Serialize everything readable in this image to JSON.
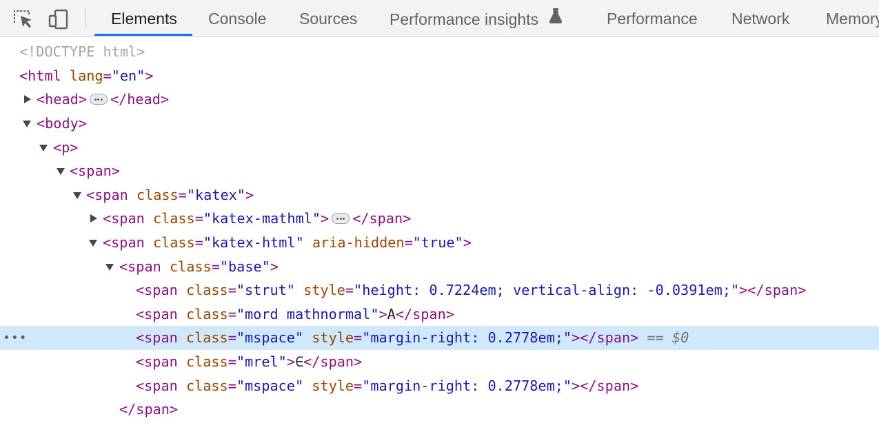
{
  "tabs": [
    "Elements",
    "Console",
    "Sources",
    "Performance insights",
    "Performance",
    "Network",
    "Memory"
  ],
  "active_tab": "Elements",
  "icons": {
    "inspect": "inspect-element-icon",
    "device": "device-toolbar-icon",
    "experiment": "flask-icon"
  },
  "tree": {
    "doctype": "<!DOCTYPE html>",
    "html": {
      "open": "<html",
      "attr": "lang",
      "eq": "=",
      "val": "\"en\"",
      "close": ">"
    },
    "head": {
      "open": "<head>",
      "close": "</head>"
    },
    "body": "<body>",
    "p": "<p>",
    "span": "<span>",
    "katex": {
      "open": "<span",
      "attr": "class",
      "val": "\"katex\"",
      "close": ">"
    },
    "mathml": {
      "open": "<span",
      "attr": "class",
      "val": "\"katex-mathml\"",
      "close": ">",
      "end": "</span>"
    },
    "html_span": {
      "open": "<span",
      "attr1": "class",
      "val1": "\"katex-html\"",
      "attr2": "aria-hidden",
      "val2": "\"true\"",
      "close": ">"
    },
    "base": {
      "open": "<span",
      "attr": "class",
      "val": "\"base\"",
      "close": ">"
    },
    "strut": {
      "open": "<span",
      "attr1": "class",
      "val1": "\"strut\"",
      "attr2": "style",
      "val2": "\"height: 0.7224em; vertical-align: -0.0391em;\"",
      "close": "></span>"
    },
    "mord": {
      "open": "<span",
      "attr": "class",
      "val": "\"mord mathnormal\"",
      "gt": ">",
      "text": "A",
      "close": "</span>"
    },
    "mspace1": {
      "open": "<span",
      "attr1": "class",
      "val1": "\"mspace\"",
      "attr2": "style",
      "val2": "\"margin-right: 0.2778em;\"",
      "close": "></span>",
      "suffix": " == $0"
    },
    "mrel": {
      "open": "<span",
      "attr": "class",
      "val": "\"mrel\"",
      "gt": ">",
      "text": "∈",
      "close": "</span>"
    },
    "mspace2": {
      "open": "<span",
      "attr1": "class",
      "val1": "\"mspace\"",
      "attr2": "style",
      "val2": "\"margin-right: 0.2778em;\"",
      "close": "></span>"
    },
    "close_span": "</span>"
  },
  "row_menu": "•••",
  "colors": {
    "tag": "#881280",
    "attr_name": "#994500",
    "attr_value": "#1a1aa6",
    "selected_row": "#cfe8fc",
    "active_tab_underline": "#1a73e8"
  }
}
